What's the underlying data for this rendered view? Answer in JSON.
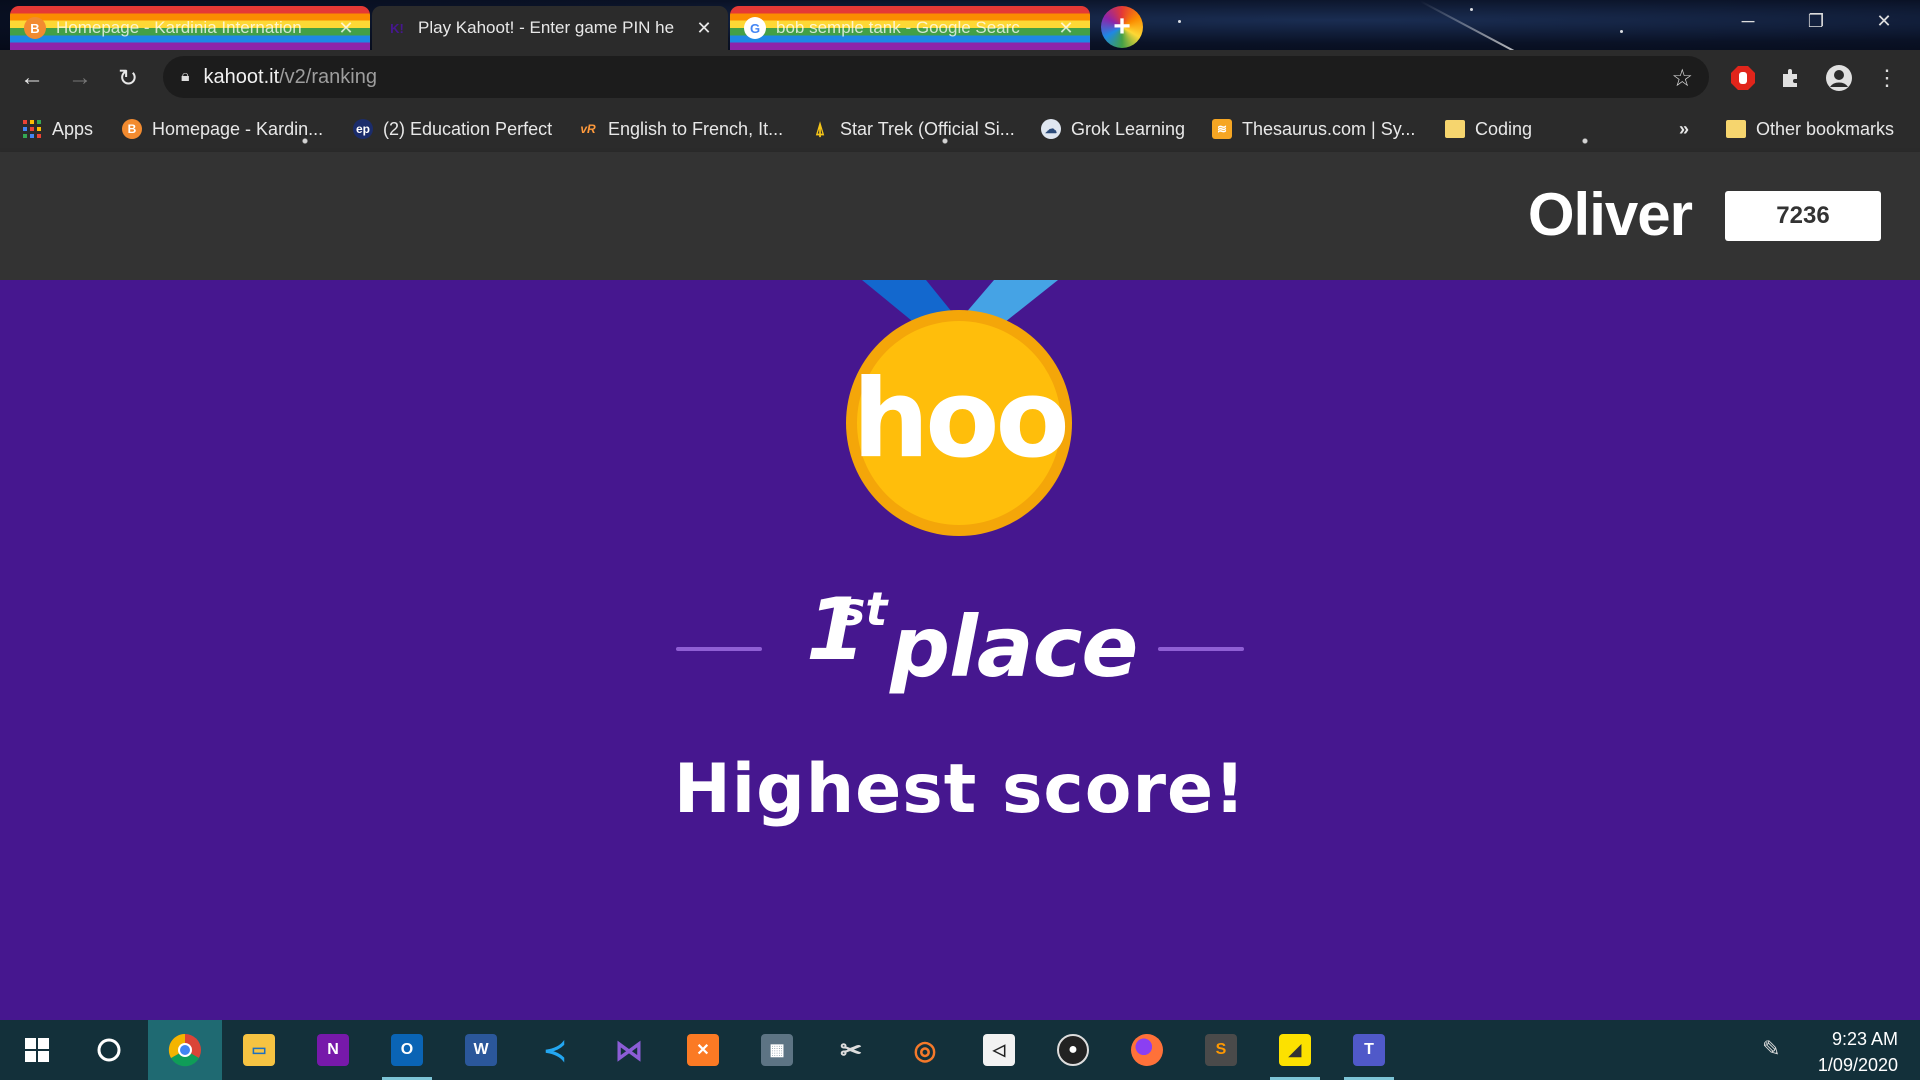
{
  "browser": {
    "tabs": [
      {
        "title": "Homepage - Kardinia Internation",
        "favicon": "B",
        "active": false
      },
      {
        "title": "Play Kahoot! - Enter game PIN he",
        "favicon": "K!",
        "active": true
      },
      {
        "title": "bob semple tank - Google Searc",
        "favicon": "G",
        "active": false
      }
    ],
    "new_tab_symbol": "+",
    "window_controls": {
      "minimize": "─",
      "restore": "❐",
      "close": "✕"
    },
    "url": {
      "host": "kahoot.it",
      "path": "/v2/ranking"
    },
    "nav": {
      "back": "←",
      "forward": "→",
      "reload": "↻"
    },
    "bookmarks": [
      {
        "label": "Apps",
        "icon": "apps-grid-icon"
      },
      {
        "label": "Homepage - Kardin...",
        "icon": "B"
      },
      {
        "label": "(2) Education Perfect",
        "icon": "ep"
      },
      {
        "label": "English to French, It...",
        "icon": "vR"
      },
      {
        "label": "Star Trek (Official Si...",
        "icon": "star-trek-icon"
      },
      {
        "label": "Grok Learning",
        "icon": "grok-icon"
      },
      {
        "label": "Thesaurus.com | Sy...",
        "icon": "thesaurus-icon"
      },
      {
        "label": "Coding",
        "icon": "folder-icon"
      }
    ],
    "bookmarks_overflow": "»",
    "other_bookmarks": "Other bookmarks"
  },
  "kahoot": {
    "player_name": "Oliver",
    "score": "7236",
    "medal_text": "hoo",
    "place_number": "1",
    "place_suffix": "st",
    "place_word": "place",
    "subtitle": "Highest score!"
  },
  "taskbar": {
    "apps": [
      "start",
      "cortana",
      "chrome",
      "file-explorer",
      "onenote",
      "outlook",
      "word",
      "vscode",
      "visual-studio",
      "xampp",
      "calculator",
      "snip",
      "blender",
      "unity",
      "obs",
      "firefox",
      "sublime",
      "sticky-notes",
      "teams"
    ],
    "time": "9:23 AM",
    "date": "1/09/2020"
  },
  "colors": {
    "kahoot_purple": "#46178f",
    "header_gray": "#333333",
    "medal_gold": "#ffbe0b",
    "ribbon_blue": "#1368ce"
  }
}
